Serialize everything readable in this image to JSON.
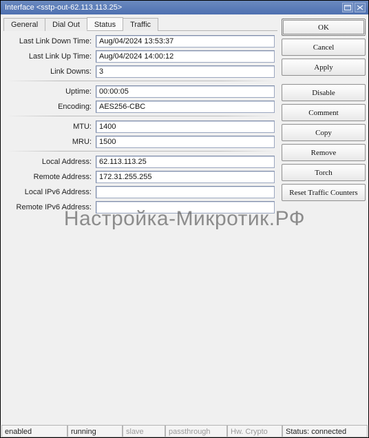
{
  "window": {
    "title": "Interface <sstp-out-62.113.113.25>"
  },
  "tabs": {
    "general": "General",
    "dial_out": "Dial Out",
    "status": "Status",
    "traffic": "Traffic"
  },
  "status": {
    "last_link_down_label": "Last Link Down Time:",
    "last_link_down": "Aug/04/2024 13:53:37",
    "last_link_up_label": "Last Link Up Time:",
    "last_link_up": "Aug/04/2024 14:00:12",
    "link_downs_label": "Link Downs:",
    "link_downs": "3",
    "uptime_label": "Uptime:",
    "uptime": "00:00:05",
    "encoding_label": "Encoding:",
    "encoding": "AES256-CBC",
    "mtu_label": "MTU:",
    "mtu": "1400",
    "mru_label": "MRU:",
    "mru": "1500",
    "local_addr_label": "Local Address:",
    "local_addr": "62.113.113.25",
    "remote_addr_label": "Remote Address:",
    "remote_addr": "172.31.255.255",
    "local_v6_label": "Local IPv6 Address:",
    "local_v6": "",
    "remote_v6_label": "Remote IPv6 Address:",
    "remote_v6": ""
  },
  "buttons": {
    "ok": "OK",
    "cancel": "Cancel",
    "apply": "Apply",
    "disable": "Disable",
    "comment": "Comment",
    "copy": "Copy",
    "remove": "Remove",
    "torch": "Torch",
    "reset": "Reset Traffic Counters"
  },
  "statusbar": {
    "enabled": "enabled",
    "running": "running",
    "slave": "slave",
    "passthrough": "passthrough",
    "hwcrypto": "Hw. Crypto",
    "status": "Status: connected"
  },
  "watermark": "Настройка-Микротик.РФ"
}
